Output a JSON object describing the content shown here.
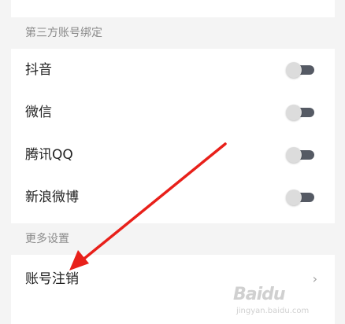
{
  "sections": {
    "third_party": {
      "title": "第三方账号绑定",
      "items": [
        {
          "label": "抖音",
          "enabled": false
        },
        {
          "label": "微信",
          "enabled": false
        },
        {
          "label": "腾讯QQ",
          "enabled": false
        },
        {
          "label": "新浪微博",
          "enabled": false
        }
      ]
    },
    "more": {
      "title": "更多设置",
      "items": [
        {
          "label": "账号注销"
        }
      ]
    }
  },
  "icons": {
    "chevron": "›"
  },
  "colors": {
    "annotation_arrow": "#e8201a",
    "toggle_track": "#555a64",
    "toggle_knob": "#dcdcdc"
  },
  "watermark": {
    "brand": "Baidu",
    "sub": "jingyan.baidu.com"
  }
}
